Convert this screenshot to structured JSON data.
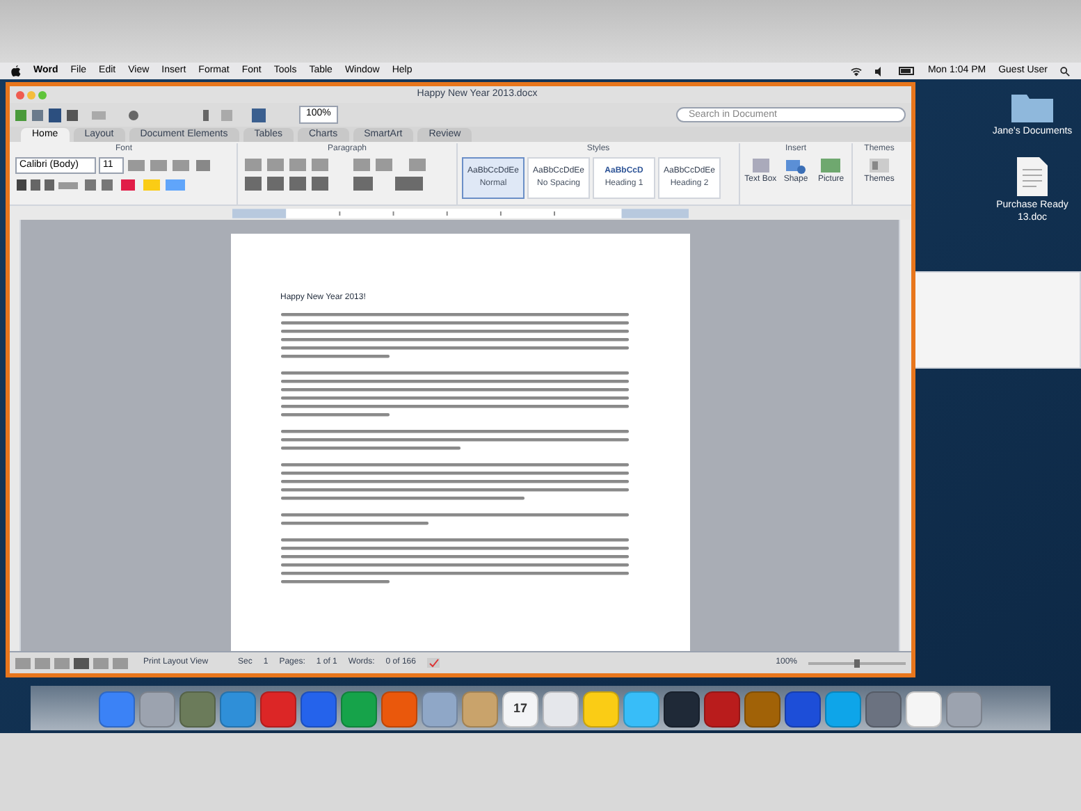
{
  "menu_bar": {
    "app": "Word",
    "items": [
      "File",
      "Edit",
      "View",
      "Insert",
      "Format",
      "Font",
      "Tools",
      "Table",
      "Window",
      "Help"
    ],
    "clock": "Mon 1:04 PM",
    "user": "Guest User"
  },
  "window": {
    "title": "Happy New Year 2013.docx",
    "zoom": "100%",
    "search": {
      "placeholder": "Search in Document"
    }
  },
  "ribbon": {
    "tabs": [
      {
        "label": "Home",
        "selected": true
      },
      {
        "label": "Layout",
        "selected": false
      },
      {
        "label": "Document Elements",
        "selected": false
      },
      {
        "label": "Tables",
        "selected": false
      },
      {
        "label": "Charts",
        "selected": false
      },
      {
        "label": "SmartArt",
        "selected": false
      },
      {
        "label": "Review",
        "selected": false
      }
    ],
    "groups": [
      "Font",
      "Paragraph",
      "Styles",
      "Insert",
      "Themes"
    ],
    "font": "Calibri (Body)",
    "size": "11",
    "styles": [
      {
        "sample": "AaBbCcDdEe",
        "name": "Normal",
        "selected": true
      },
      {
        "sample": "AaBbCcDdEe",
        "name": "No Spacing",
        "selected": false
      },
      {
        "sample": "AaBbCcD",
        "name": "Heading 1",
        "selected": false
      },
      {
        "sample": "AaBbCcDdEe",
        "name": "Heading 2",
        "selected": false
      }
    ],
    "insert": [
      "Text Box",
      "Shape",
      "Picture"
    ],
    "themes": "Themes"
  },
  "document": {
    "heading": "Happy New Year 2013!"
  },
  "status_bar": {
    "view": "Print Layout View",
    "section": "Sec",
    "section_no": "1",
    "pages_label": "Pages:",
    "pages": "1 of 1",
    "words_label": "Words:",
    "words": "0 of 166",
    "zoom": "100%",
    "zoom_slider": {
      "level": 0.5
    }
  },
  "desktop_icons": [
    {
      "kind": "folder",
      "label": "Jane's Documents"
    },
    {
      "kind": "document",
      "label": "Purchase Ready 13.doc"
    }
  ],
  "dock": [
    {
      "color": "#3b82f6"
    },
    {
      "color": "#9ca3af"
    },
    {
      "color": "#6b7b5a"
    },
    {
      "color": "#2f8fd8"
    },
    {
      "color": "#dc2626"
    },
    {
      "color": "#2563eb"
    },
    {
      "color": "#16a34a"
    },
    {
      "color": "#ea580c"
    },
    {
      "color": "#8fa7c7"
    },
    {
      "color": "#c9a36b"
    },
    {
      "color": "#f3f4f6",
      "label": "17"
    },
    {
      "color": "#e5e7eb"
    },
    {
      "color": "#facc15"
    },
    {
      "color": "#38bdf8"
    },
    {
      "color": "#1f2937"
    },
    {
      "color": "#b91c1c"
    },
    {
      "color": "#a16207"
    },
    {
      "color": "#1d4ed8"
    },
    {
      "color": "#0ea5e9"
    },
    {
      "color": "#6b7280"
    },
    {
      "color": "#f5f5f5"
    },
    {
      "color": "#9ca3af"
    }
  ]
}
